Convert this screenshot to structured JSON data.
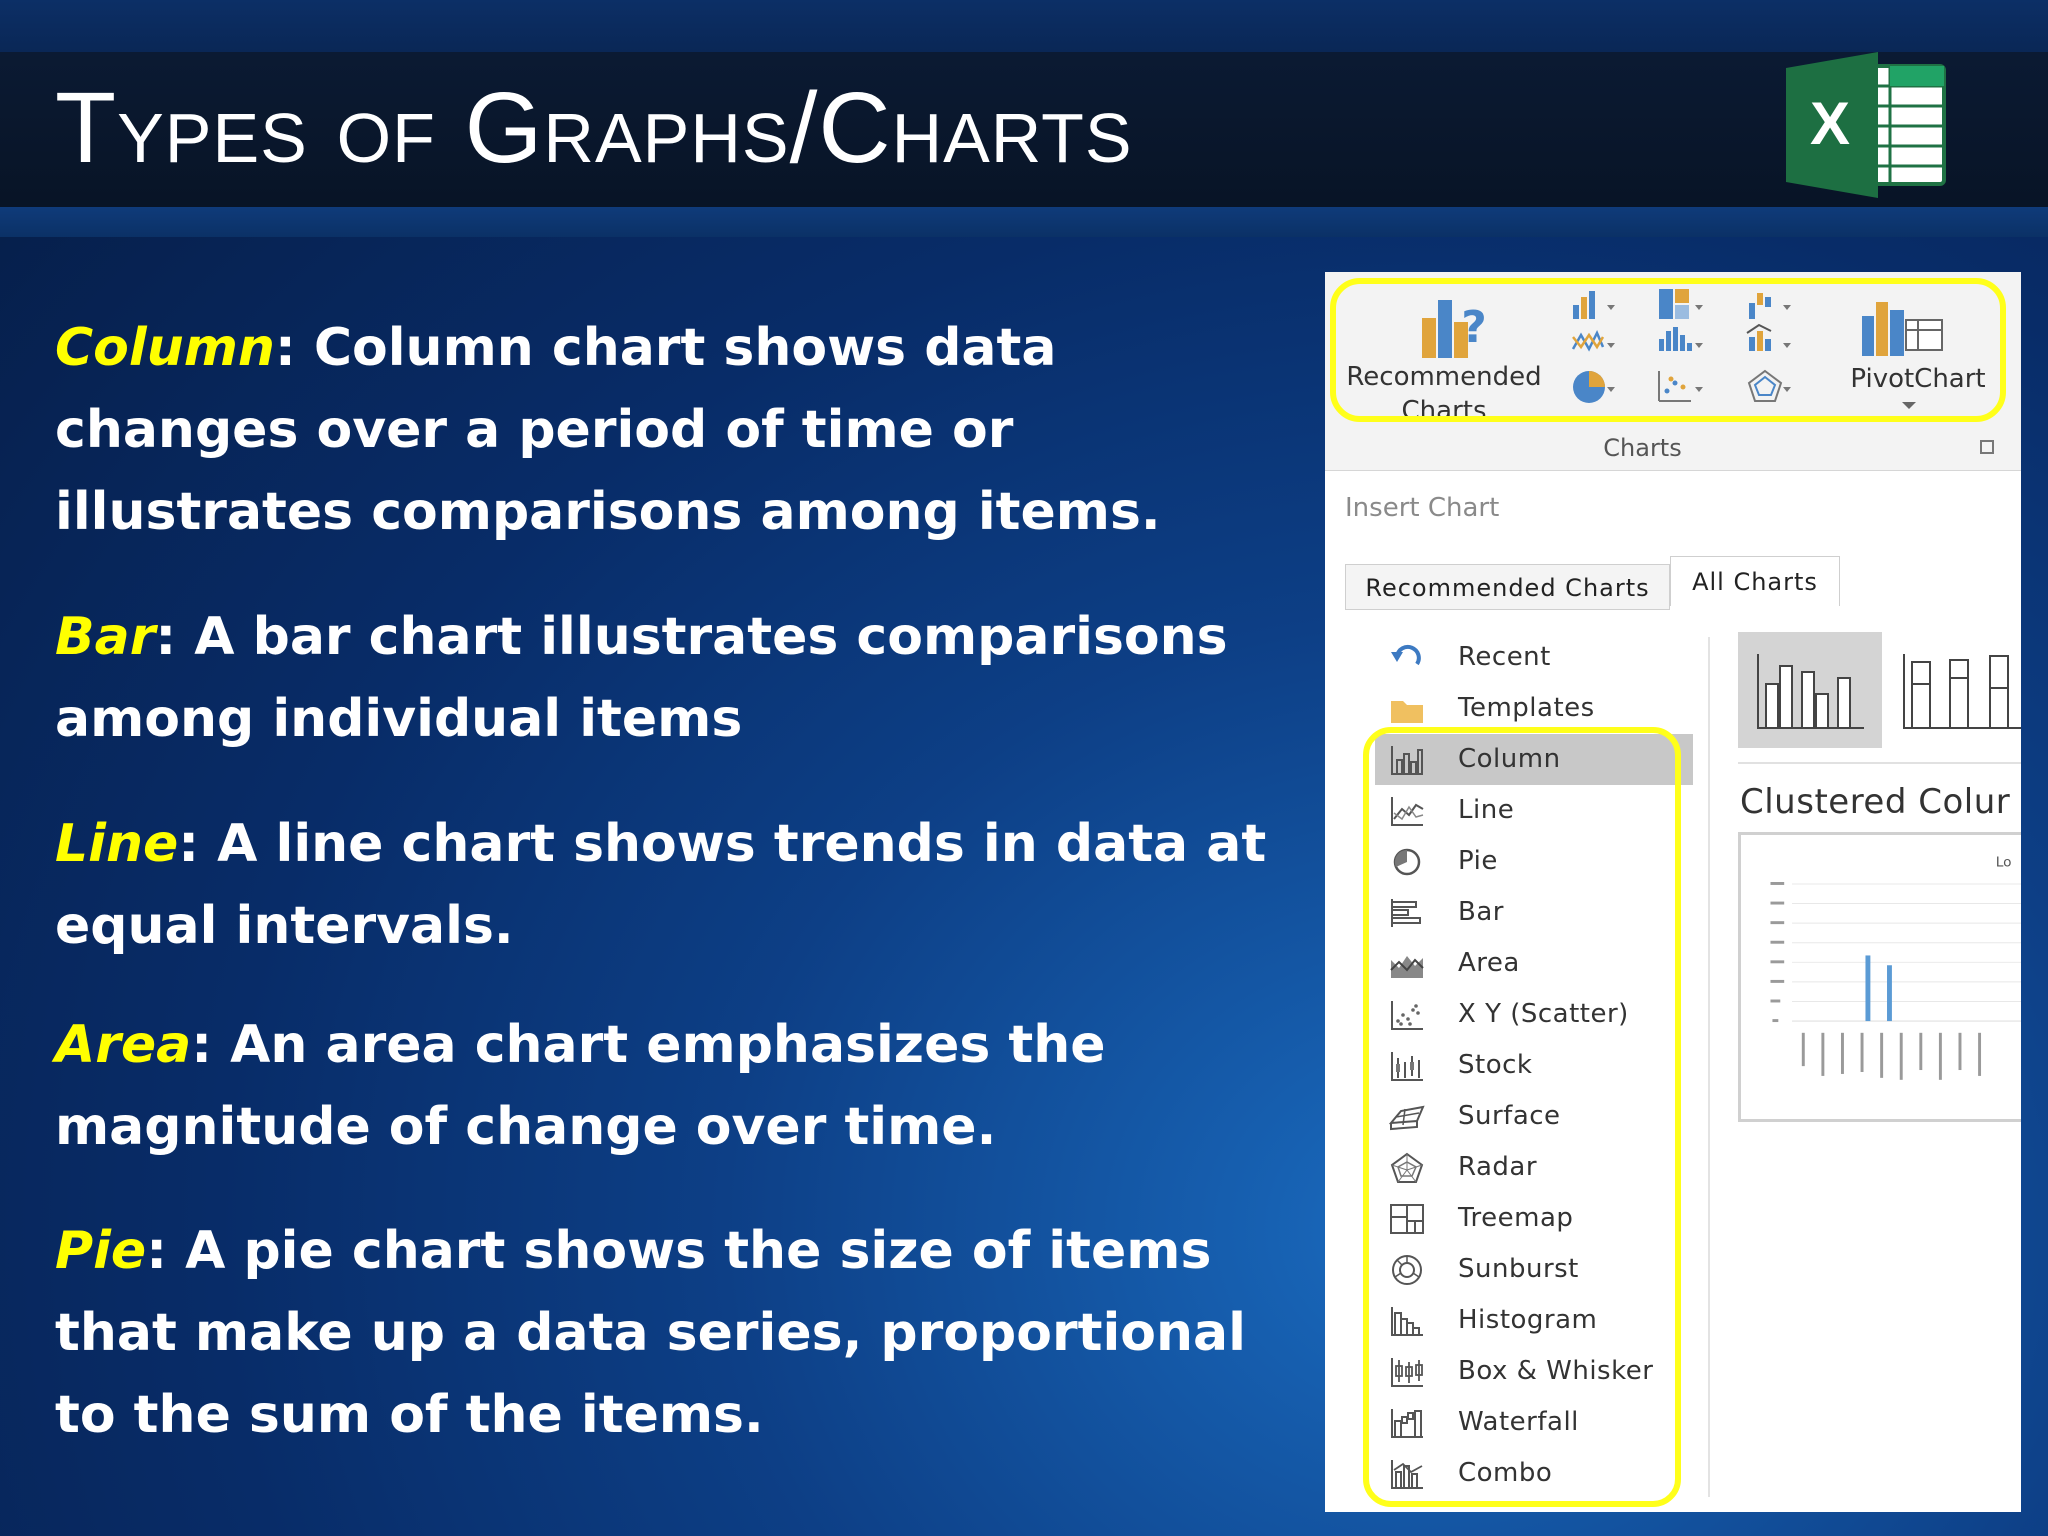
{
  "slide": {
    "title": "Types of Graphs/Charts",
    "logo": "excel-logo",
    "items": [
      {
        "term": "Column",
        "text": ": Column chart shows data changes over a period of time or illustrates  comparisons among items."
      },
      {
        "term": "Bar",
        "text": ": A bar chart illustrates comparisons among individual items"
      },
      {
        "term": "Line",
        "text": ": A line chart shows trends in data at equal intervals."
      },
      {
        "term": "Area",
        "text": ": An area chart emphasizes the magnitude of change over time."
      },
      {
        "term": "Pie",
        "text": ": A pie chart shows the size of items that make up a data series, proportional to the sum of the items."
      }
    ]
  },
  "ribbon": {
    "recommended_label": "Recommended Charts",
    "pivot_label": "PivotChart",
    "group_label": "Charts",
    "highlight_color": "#ffff1a"
  },
  "dialog": {
    "title": "Insert Chart",
    "tabs": [
      "Recommended Charts",
      "All Charts"
    ],
    "active_tab": "All Charts",
    "chart_types": [
      {
        "label": "Recent",
        "icon": "recent-icon"
      },
      {
        "label": "Templates",
        "icon": "folder-icon"
      },
      {
        "label": "Column",
        "icon": "column-chart-icon",
        "selected": true
      },
      {
        "label": "Line",
        "icon": "line-chart-icon"
      },
      {
        "label": "Pie",
        "icon": "pie-chart-icon"
      },
      {
        "label": "Bar",
        "icon": "bar-chart-icon"
      },
      {
        "label": "Area",
        "icon": "area-chart-icon"
      },
      {
        "label": "X Y (Scatter)",
        "icon": "scatter-chart-icon"
      },
      {
        "label": "Stock",
        "icon": "stock-chart-icon"
      },
      {
        "label": "Surface",
        "icon": "surface-chart-icon"
      },
      {
        "label": "Radar",
        "icon": "radar-chart-icon"
      },
      {
        "label": "Treemap",
        "icon": "treemap-chart-icon"
      },
      {
        "label": "Sunburst",
        "icon": "sunburst-chart-icon"
      },
      {
        "label": "Histogram",
        "icon": "histogram-chart-icon"
      },
      {
        "label": "Box & Whisker",
        "icon": "box-whisker-chart-icon"
      },
      {
        "label": "Waterfall",
        "icon": "waterfall-chart-icon"
      },
      {
        "label": "Combo",
        "icon": "combo-chart-icon"
      }
    ],
    "selected_subtype": "Clustered Colur",
    "preview_corner_text": "Lo"
  }
}
